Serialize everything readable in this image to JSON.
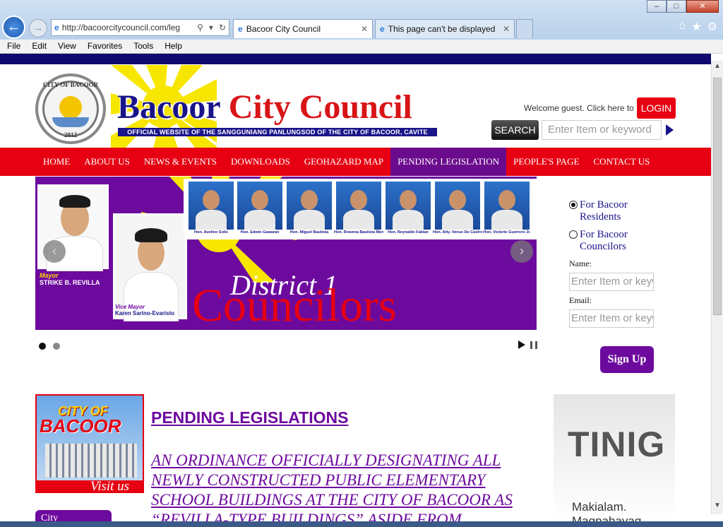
{
  "browser": {
    "url": "http://bacoorcitycouncil.com/leg",
    "tabs": [
      {
        "label": "Bacoor City Council"
      },
      {
        "label": "This page can't be displayed"
      }
    ],
    "menu": [
      "File",
      "Edit",
      "View",
      "Favorites",
      "Tools",
      "Help"
    ]
  },
  "header": {
    "seal_top": "CITY OF BACOOR",
    "seal_year": "2012",
    "title_part1": "Bacoor",
    "title_part2": "City Council",
    "tagline": "OFFICIAL WEBSITE OF THE SANGGUNIANG PANLUNGSOD OF THE CITY OF BACOOR, CAVITE",
    "welcome": "Welcome guest. Click here to",
    "login": "LOGIN",
    "search_button": "SEARCH",
    "search_placeholder": "Enter Item or keyword"
  },
  "nav": {
    "items": [
      {
        "label": "HOME"
      },
      {
        "label": "ABOUT US"
      },
      {
        "label": "NEWS & EVENTS"
      },
      {
        "label": "DOWNLOADS"
      },
      {
        "label": "GEOHAZARD MAP"
      },
      {
        "label": "PENDING LEGISLATION",
        "active": true
      },
      {
        "label": "PEOPLE'S PAGE"
      },
      {
        "label": "CONTACT US"
      }
    ]
  },
  "slider": {
    "mayor_role": "Mayor",
    "mayor_name": "STRIKE B. REVILLA",
    "vice_role": "Vice Mayor",
    "vice_name": "Karen Sarino-Evaristo",
    "councilors": [
      "Hon. Avelino Solis",
      "Hon. Edwin Gawaran",
      "Hon. Miguel Bautista",
      "Hon. Rowena Bautista Mendiola",
      "Hon. Reynaldo Fabian",
      "Hon. Atty. Venus De Castro",
      "Hon. Victorio Guerrero Jr."
    ],
    "heading1": "District 1",
    "heading2": "Councilors",
    "current_slide": 1,
    "slide_count": 2
  },
  "subscribe": {
    "option1": "For Bacoor Residents",
    "option2": "For Bacoor Councilors",
    "selected": "option1",
    "name_label": "Name:",
    "name_placeholder": "Enter Item or keyword",
    "email_label": "Email:",
    "email_placeholder": "Enter Item or keyword",
    "signup": "Sign Up"
  },
  "content": {
    "visit_city_of": "CITY OF",
    "visit_bacoor": "BACOOR",
    "visit_label": "Visit us",
    "city_box": "City",
    "section_title": "PENDING LEGISLATIONS",
    "ordinance": "AN ORDINANCE OFFICIALLY DESIGNATING ALL NEWLY CONSTRUCTED PUBLIC ELEMENTARY SCHOOL BUILDINGS AT THE CITY OF BACOOR AS “REVILLA-TYPE BUILDINGS” ASIDE FROM",
    "tinig": "TINIG",
    "makialam": "Makialam. Magpahayag."
  },
  "colors": {
    "navy": "#1a148a",
    "red": "#e60012",
    "purple": "#6d0a9e"
  }
}
